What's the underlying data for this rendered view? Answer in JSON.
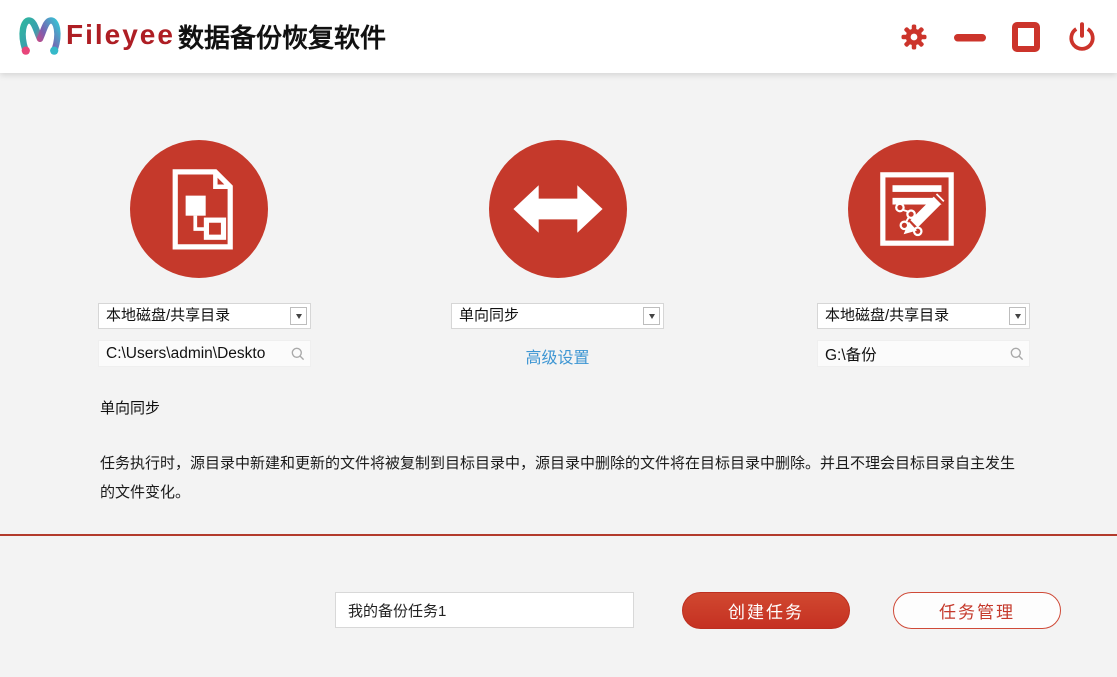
{
  "header": {
    "brand": "Fileyee",
    "title": "数据备份恢复软件",
    "controls": {
      "settings_icon": "gear-icon",
      "minimize_icon": "minus-icon",
      "maximize_icon": "square-icon",
      "close_icon": "power-icon"
    }
  },
  "source": {
    "type": "本地磁盘/共享目录",
    "path": "C:\\Users\\admin\\Deskto",
    "icon": "file-diagram-icon"
  },
  "sync": {
    "mode": "单向同步",
    "advanced": "高级设置",
    "icon": "double-arrow-icon"
  },
  "target": {
    "type": "本地磁盘/共享目录",
    "path": "G:\\备份",
    "icon": "edit-note-icon"
  },
  "description": {
    "title": "单向同步",
    "body": "任务执行时，源目录中新建和更新的文件将被复制到目标目录中，源目录中删除的文件将在目标目录中删除。并且不理会目标目录自主发生的文件变化。"
  },
  "footer": {
    "task_name": "我的备份任务1",
    "create_label": "创建任务",
    "manage_label": "任务管理"
  },
  "colors": {
    "accent_red": "#c5392b",
    "brand_red": "#ae1e24",
    "divider_red": "#b23a2b",
    "link_blue": "#3e96d3",
    "page_bg": "#f3f3f3"
  }
}
